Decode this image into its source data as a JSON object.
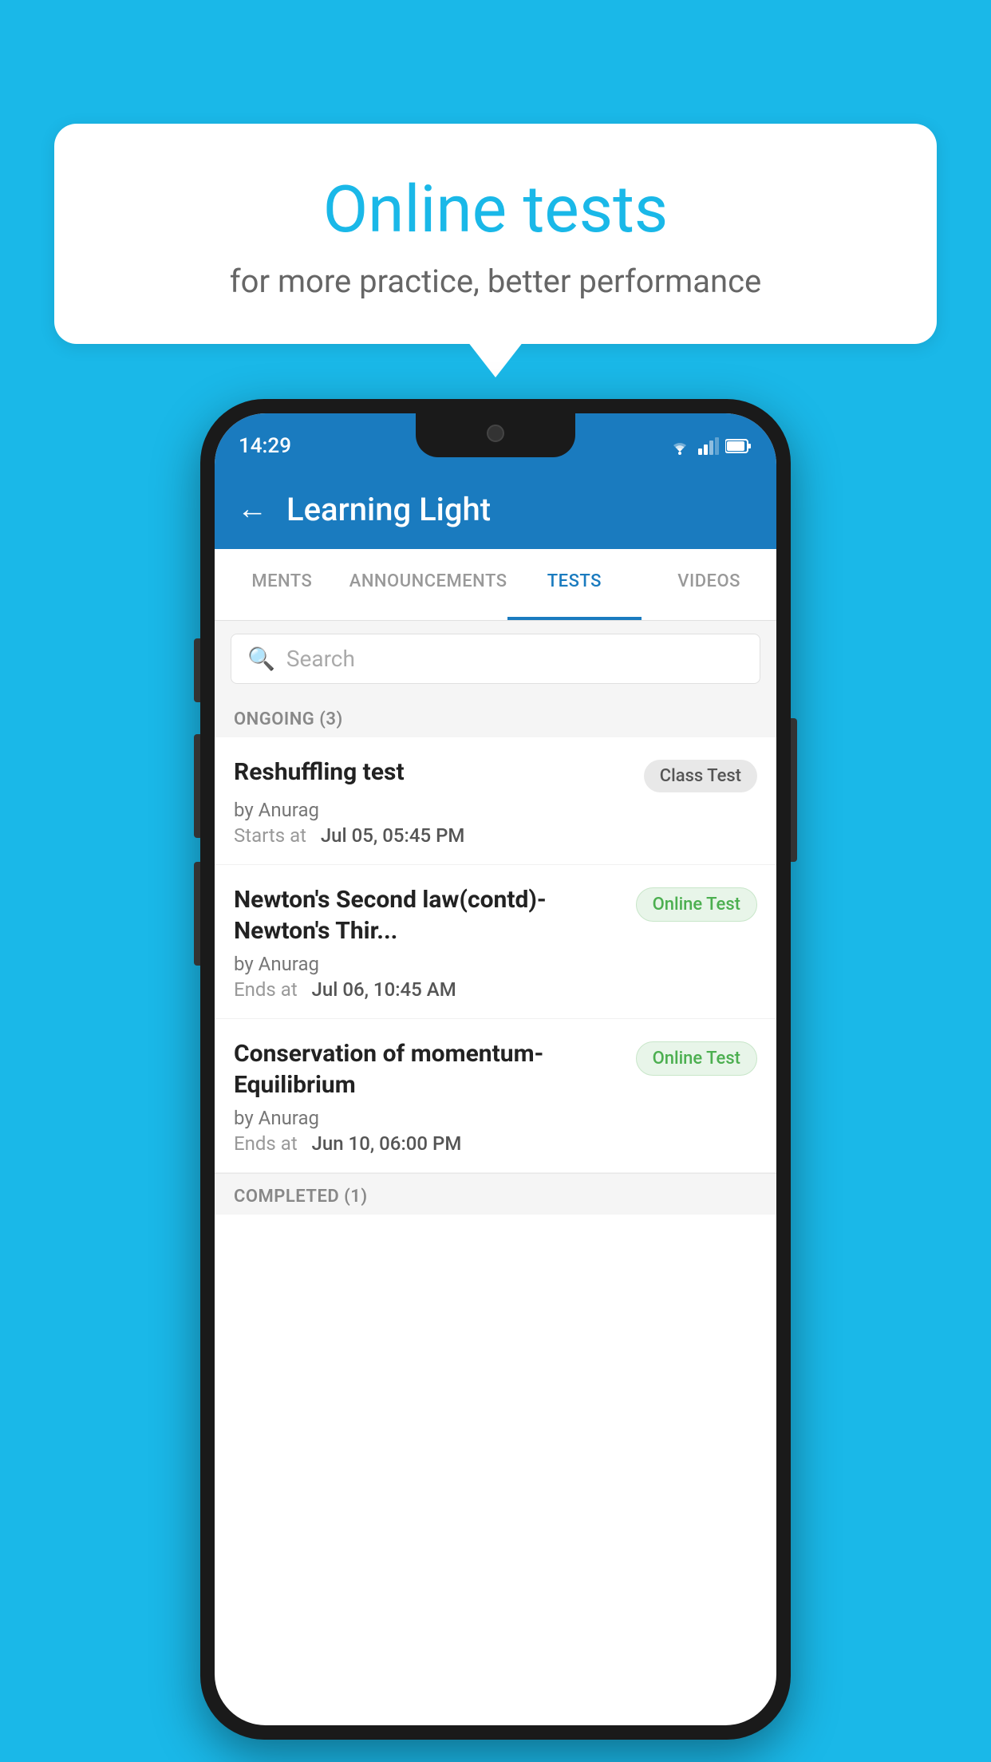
{
  "background_color": "#1ab8e8",
  "bubble": {
    "title": "Online tests",
    "subtitle": "for more practice, better performance"
  },
  "phone": {
    "status_bar": {
      "time": "14:29"
    },
    "app_bar": {
      "title": "Learning Light",
      "back_label": "←"
    },
    "tabs": [
      {
        "id": "ments",
        "label": "MENTS",
        "active": false
      },
      {
        "id": "announcements",
        "label": "ANNOUNCEMENTS",
        "active": false
      },
      {
        "id": "tests",
        "label": "TESTS",
        "active": true
      },
      {
        "id": "videos",
        "label": "VIDEOS",
        "active": false
      }
    ],
    "search": {
      "placeholder": "Search"
    },
    "sections": [
      {
        "id": "ongoing",
        "label": "ONGOING (3)",
        "tests": [
          {
            "id": "reshuffling",
            "title": "Reshuffling test",
            "author": "by Anurag",
            "date_label": "Starts at",
            "date_value": "Jul 05, 05:45 PM",
            "badge": "Class Test",
            "badge_type": "gray"
          },
          {
            "id": "newtons-second",
            "title": "Newton's Second law(contd)-Newton's Thir...",
            "author": "by Anurag",
            "date_label": "Ends at",
            "date_value": "Jul 06, 10:45 AM",
            "badge": "Online Test",
            "badge_type": "green"
          },
          {
            "id": "conservation",
            "title": "Conservation of momentum-Equilibrium",
            "author": "by Anurag",
            "date_label": "Ends at",
            "date_value": "Jun 10, 06:00 PM",
            "badge": "Online Test",
            "badge_type": "green"
          }
        ]
      }
    ],
    "bottom_section_label": "COMPLETED (1)"
  }
}
